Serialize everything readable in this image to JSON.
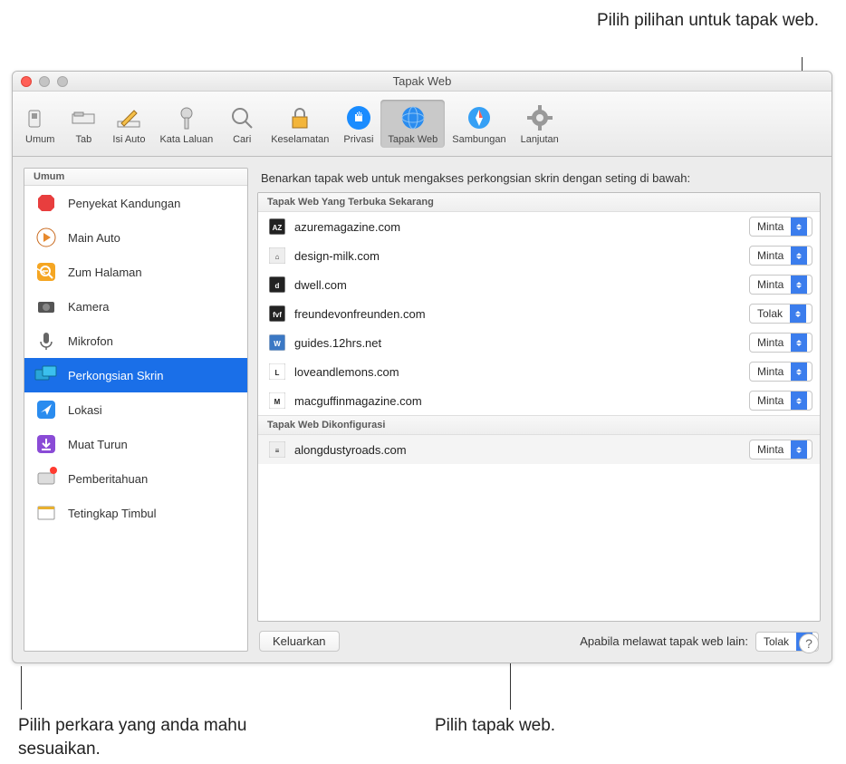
{
  "callouts": {
    "top_right": "Pilih pilihan untuk tapak web.",
    "bottom_left": "Pilih perkara yang anda mahu sesuaikan.",
    "bottom_center": "Pilih tapak web."
  },
  "window": {
    "title": "Tapak Web",
    "help_label": "?"
  },
  "toolbar": {
    "items": [
      {
        "label": "Umum"
      },
      {
        "label": "Tab"
      },
      {
        "label": "Isi Auto"
      },
      {
        "label": "Kata Laluan"
      },
      {
        "label": "Cari"
      },
      {
        "label": "Keselamatan"
      },
      {
        "label": "Privasi"
      },
      {
        "label": "Tapak Web"
      },
      {
        "label": "Sambungan"
      },
      {
        "label": "Lanjutan"
      }
    ]
  },
  "sidebar": {
    "header": "Umum",
    "items": [
      {
        "label": "Penyekat Kandungan"
      },
      {
        "label": "Main Auto"
      },
      {
        "label": "Zum Halaman"
      },
      {
        "label": "Kamera"
      },
      {
        "label": "Mikrofon"
      },
      {
        "label": "Perkongsian Skrin"
      },
      {
        "label": "Lokasi"
      },
      {
        "label": "Muat Turun"
      },
      {
        "label": "Pemberitahuan"
      },
      {
        "label": "Tetingkap Timbul"
      }
    ]
  },
  "main": {
    "description": "Benarkan tapak web untuk mengakses perkongsian skrin dengan seting di bawah:",
    "section_open": "Tapak Web Yang Terbuka Sekarang",
    "section_config": "Tapak Web Dikonfigurasi",
    "sites_open": [
      {
        "name": "azuremagazine.com",
        "value": "Minta",
        "icon": "AZ"
      },
      {
        "name": "design-milk.com",
        "value": "Minta",
        "icon": "⌂"
      },
      {
        "name": "dwell.com",
        "value": "Minta",
        "icon": "d"
      },
      {
        "name": "freundevonfreunden.com",
        "value": "Tolak",
        "icon": "fvf"
      },
      {
        "name": "guides.12hrs.net",
        "value": "Minta",
        "icon": "W"
      },
      {
        "name": "loveandlemons.com",
        "value": "Minta",
        "icon": "L"
      },
      {
        "name": "macguffinmagazine.com",
        "value": "Minta",
        "icon": "M"
      }
    ],
    "sites_config": [
      {
        "name": "alongdustyroads.com",
        "value": "Minta",
        "icon": "≡"
      }
    ],
    "remove_button": "Keluarkan",
    "other_label": "Apabila melawat tapak web lain:",
    "other_value": "Tolak"
  }
}
